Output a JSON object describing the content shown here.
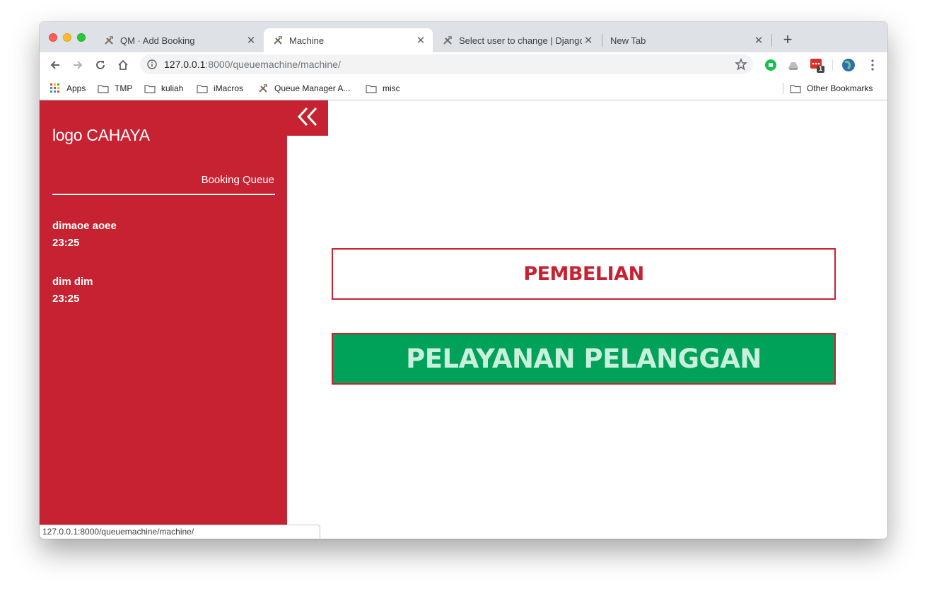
{
  "browser": {
    "tabs": [
      {
        "title": "QM · Add Booking",
        "active": false,
        "icon": "tools-icon"
      },
      {
        "title": "Machine",
        "active": true,
        "icon": "tools-icon"
      },
      {
        "title": "Select user to change | Django",
        "active": false,
        "icon": "tools-icon"
      },
      {
        "title": "New Tab",
        "active": false,
        "icon": ""
      }
    ],
    "url_host": "127.0.0.1",
    "url_rest": ":8000/queuemachine/machine/",
    "extension_badge": "1",
    "bookmarks": [
      {
        "label": "Apps",
        "icon": "apps-grid-icon"
      },
      {
        "label": "TMP",
        "icon": "folder-icon"
      },
      {
        "label": "kuliah",
        "icon": "folder-icon"
      },
      {
        "label": "iMacros",
        "icon": "folder-icon"
      },
      {
        "label": "Queue Manager A...",
        "icon": "tools-icon"
      },
      {
        "label": "misc",
        "icon": "folder-icon"
      }
    ],
    "other_bookmarks": "Other Bookmarks",
    "status_url": "127.0.0.1:8000/queuemachine/machine/"
  },
  "app": {
    "logo": "logo CAHAYA",
    "queue_title": "Booking Queue",
    "queue": [
      {
        "name": "dimaoe aoee",
        "time": "23:25"
      },
      {
        "name": "dim dim",
        "time": "23:25"
      }
    ],
    "buttons": {
      "purchase": "PEMBELIAN",
      "customer_service": "PELAYANAN PELANGGAN"
    }
  },
  "colors": {
    "brand_red": "#c62232",
    "service_green": "#00a25a",
    "service_text": "#c9f0dc"
  }
}
